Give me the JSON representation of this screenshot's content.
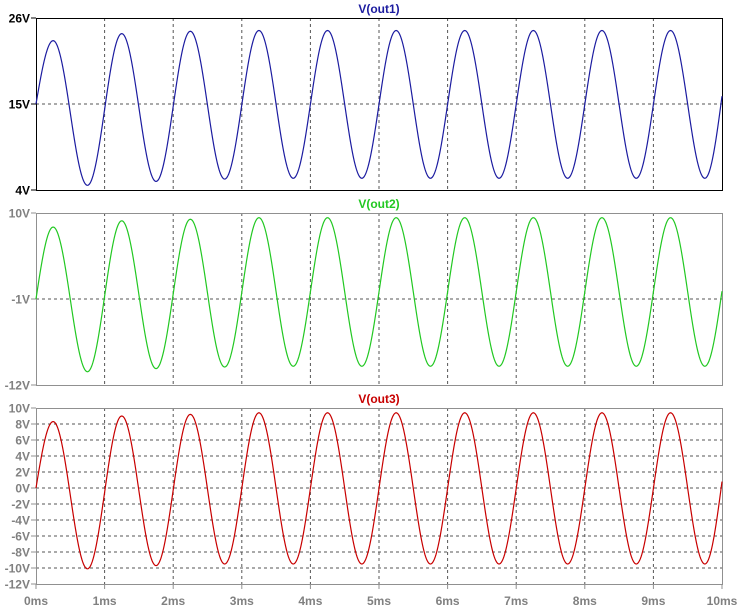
{
  "chart_data": [
    {
      "type": "line",
      "title": "V(out1)",
      "active": true,
      "color": "#1c1ca0",
      "ylim": [
        4,
        26
      ],
      "yticks": [
        {
          "v": 26,
          "label": "26V"
        },
        {
          "v": 15,
          "label": "15V"
        },
        {
          "v": 4,
          "label": "4V"
        }
      ],
      "hgrid": [
        15
      ],
      "start_value": 15,
      "end_value": 16.0,
      "peaks": [
        23.1,
        24.0,
        24.3,
        24.4,
        24.4,
        24.4,
        24.4,
        24.4,
        24.4,
        24.4
      ],
      "troughs": [
        4.6,
        5.1,
        5.4,
        5.5,
        5.5,
        5.5,
        5.5,
        5.5,
        5.5,
        5.5
      ]
    },
    {
      "type": "line",
      "title": "V(out2)",
      "active": false,
      "color": "#22c822",
      "ylim": [
        -12,
        10
      ],
      "yticks": [
        {
          "v": 10,
          "label": "10V"
        },
        {
          "v": -1,
          "label": "-1V"
        },
        {
          "v": -12,
          "label": "-12V"
        }
      ],
      "hgrid": [
        -1
      ],
      "start_value": -1,
      "end_value": 0.0,
      "peaks": [
        8.2,
        9.0,
        9.2,
        9.4,
        9.4,
        9.4,
        9.4,
        9.4,
        9.4,
        9.4
      ],
      "troughs": [
        -10.3,
        -9.9,
        -9.7,
        -9.6,
        -9.6,
        -9.6,
        -9.6,
        -9.6,
        -9.6,
        -9.6
      ]
    },
    {
      "type": "line",
      "title": "V(out3)",
      "active": false,
      "color": "#c80000",
      "ylim": [
        -12,
        10
      ],
      "yticks": [
        {
          "v": 10,
          "label": "10V"
        },
        {
          "v": 8,
          "label": "8V"
        },
        {
          "v": 6,
          "label": "6V"
        },
        {
          "v": 4,
          "label": "4V"
        },
        {
          "v": 2,
          "label": "2V"
        },
        {
          "v": 0,
          "label": "0V"
        },
        {
          "v": -2,
          "label": "-2V"
        },
        {
          "v": -4,
          "label": "-4V"
        },
        {
          "v": -6,
          "label": "-6V"
        },
        {
          "v": -8,
          "label": "-8V"
        },
        {
          "v": -10,
          "label": "-10V"
        },
        {
          "v": -12,
          "label": "-12V"
        }
      ],
      "hgrid": [
        8,
        6,
        4,
        2,
        0,
        -2,
        -4,
        -6,
        -8,
        -10
      ],
      "start_value": 0,
      "end_value": 0.8,
      "peaks": [
        8.3,
        9.0,
        9.2,
        9.4,
        9.4,
        9.4,
        9.4,
        9.4,
        9.4,
        9.4
      ],
      "troughs": [
        -10.1,
        -9.7,
        -9.5,
        -9.5,
        -9.5,
        -9.5,
        -9.5,
        -9.5,
        -9.5,
        -9.5
      ]
    }
  ],
  "x_axis": {
    "xlim": [
      0,
      10
    ],
    "unit": "ms",
    "ticks": [
      {
        "v": 0,
        "label": "0ms"
      },
      {
        "v": 1,
        "label": "1ms"
      },
      {
        "v": 2,
        "label": "2ms"
      },
      {
        "v": 3,
        "label": "3ms"
      },
      {
        "v": 4,
        "label": "4ms"
      },
      {
        "v": 5,
        "label": "5ms"
      },
      {
        "v": 6,
        "label": "6ms"
      },
      {
        "v": 7,
        "label": "7ms"
      },
      {
        "v": 8,
        "label": "8ms"
      },
      {
        "v": 9,
        "label": "9ms"
      },
      {
        "v": 10,
        "label": "10ms"
      }
    ]
  }
}
